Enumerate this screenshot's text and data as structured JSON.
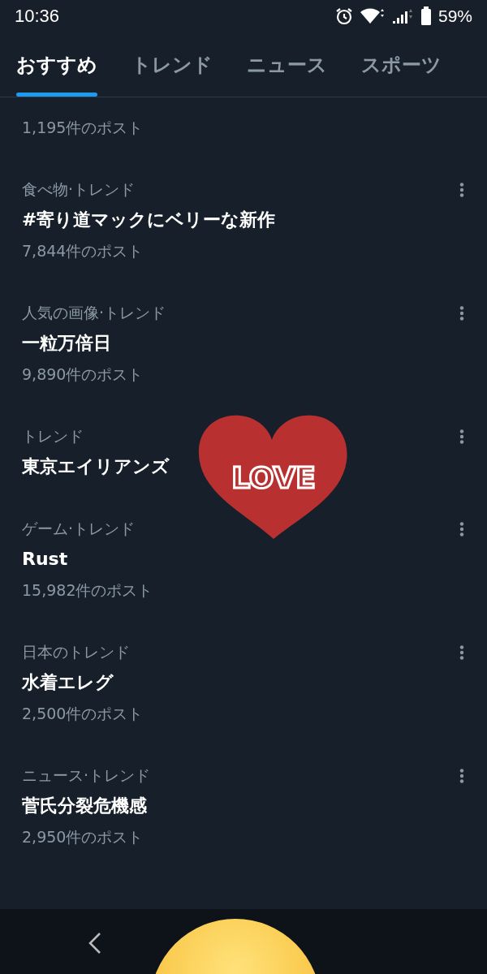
{
  "status_bar": {
    "time": "10:36",
    "battery": "59%"
  },
  "tabs": [
    {
      "label": "おすすめ",
      "selected": true
    },
    {
      "label": "トレンド",
      "selected": false
    },
    {
      "label": "ニュース",
      "selected": false
    },
    {
      "label": "スポーツ",
      "selected": false
    }
  ],
  "trends": [
    {
      "count": "1,195件のポスト"
    },
    {
      "context": "食べ物·トレンド",
      "title": "#寄り道マックにベリーな新作",
      "count": "7,844件のポスト"
    },
    {
      "context": "人気の画像·トレンド",
      "title": "一粒万倍日",
      "count": "9,890件のポスト"
    },
    {
      "context": "トレンド",
      "title": "東京エイリアンズ"
    },
    {
      "context": "ゲーム·トレンド",
      "title": "Rust",
      "count": "15,982件のポスト"
    },
    {
      "context": "日本のトレンド",
      "title": "水着エレグ",
      "count": "2,500件のポスト"
    },
    {
      "context": "ニュース·トレンド",
      "title": "菅氏分裂危機感",
      "count": "2,950件のポスト"
    }
  ],
  "sticker": {
    "text": "LOVE"
  }
}
